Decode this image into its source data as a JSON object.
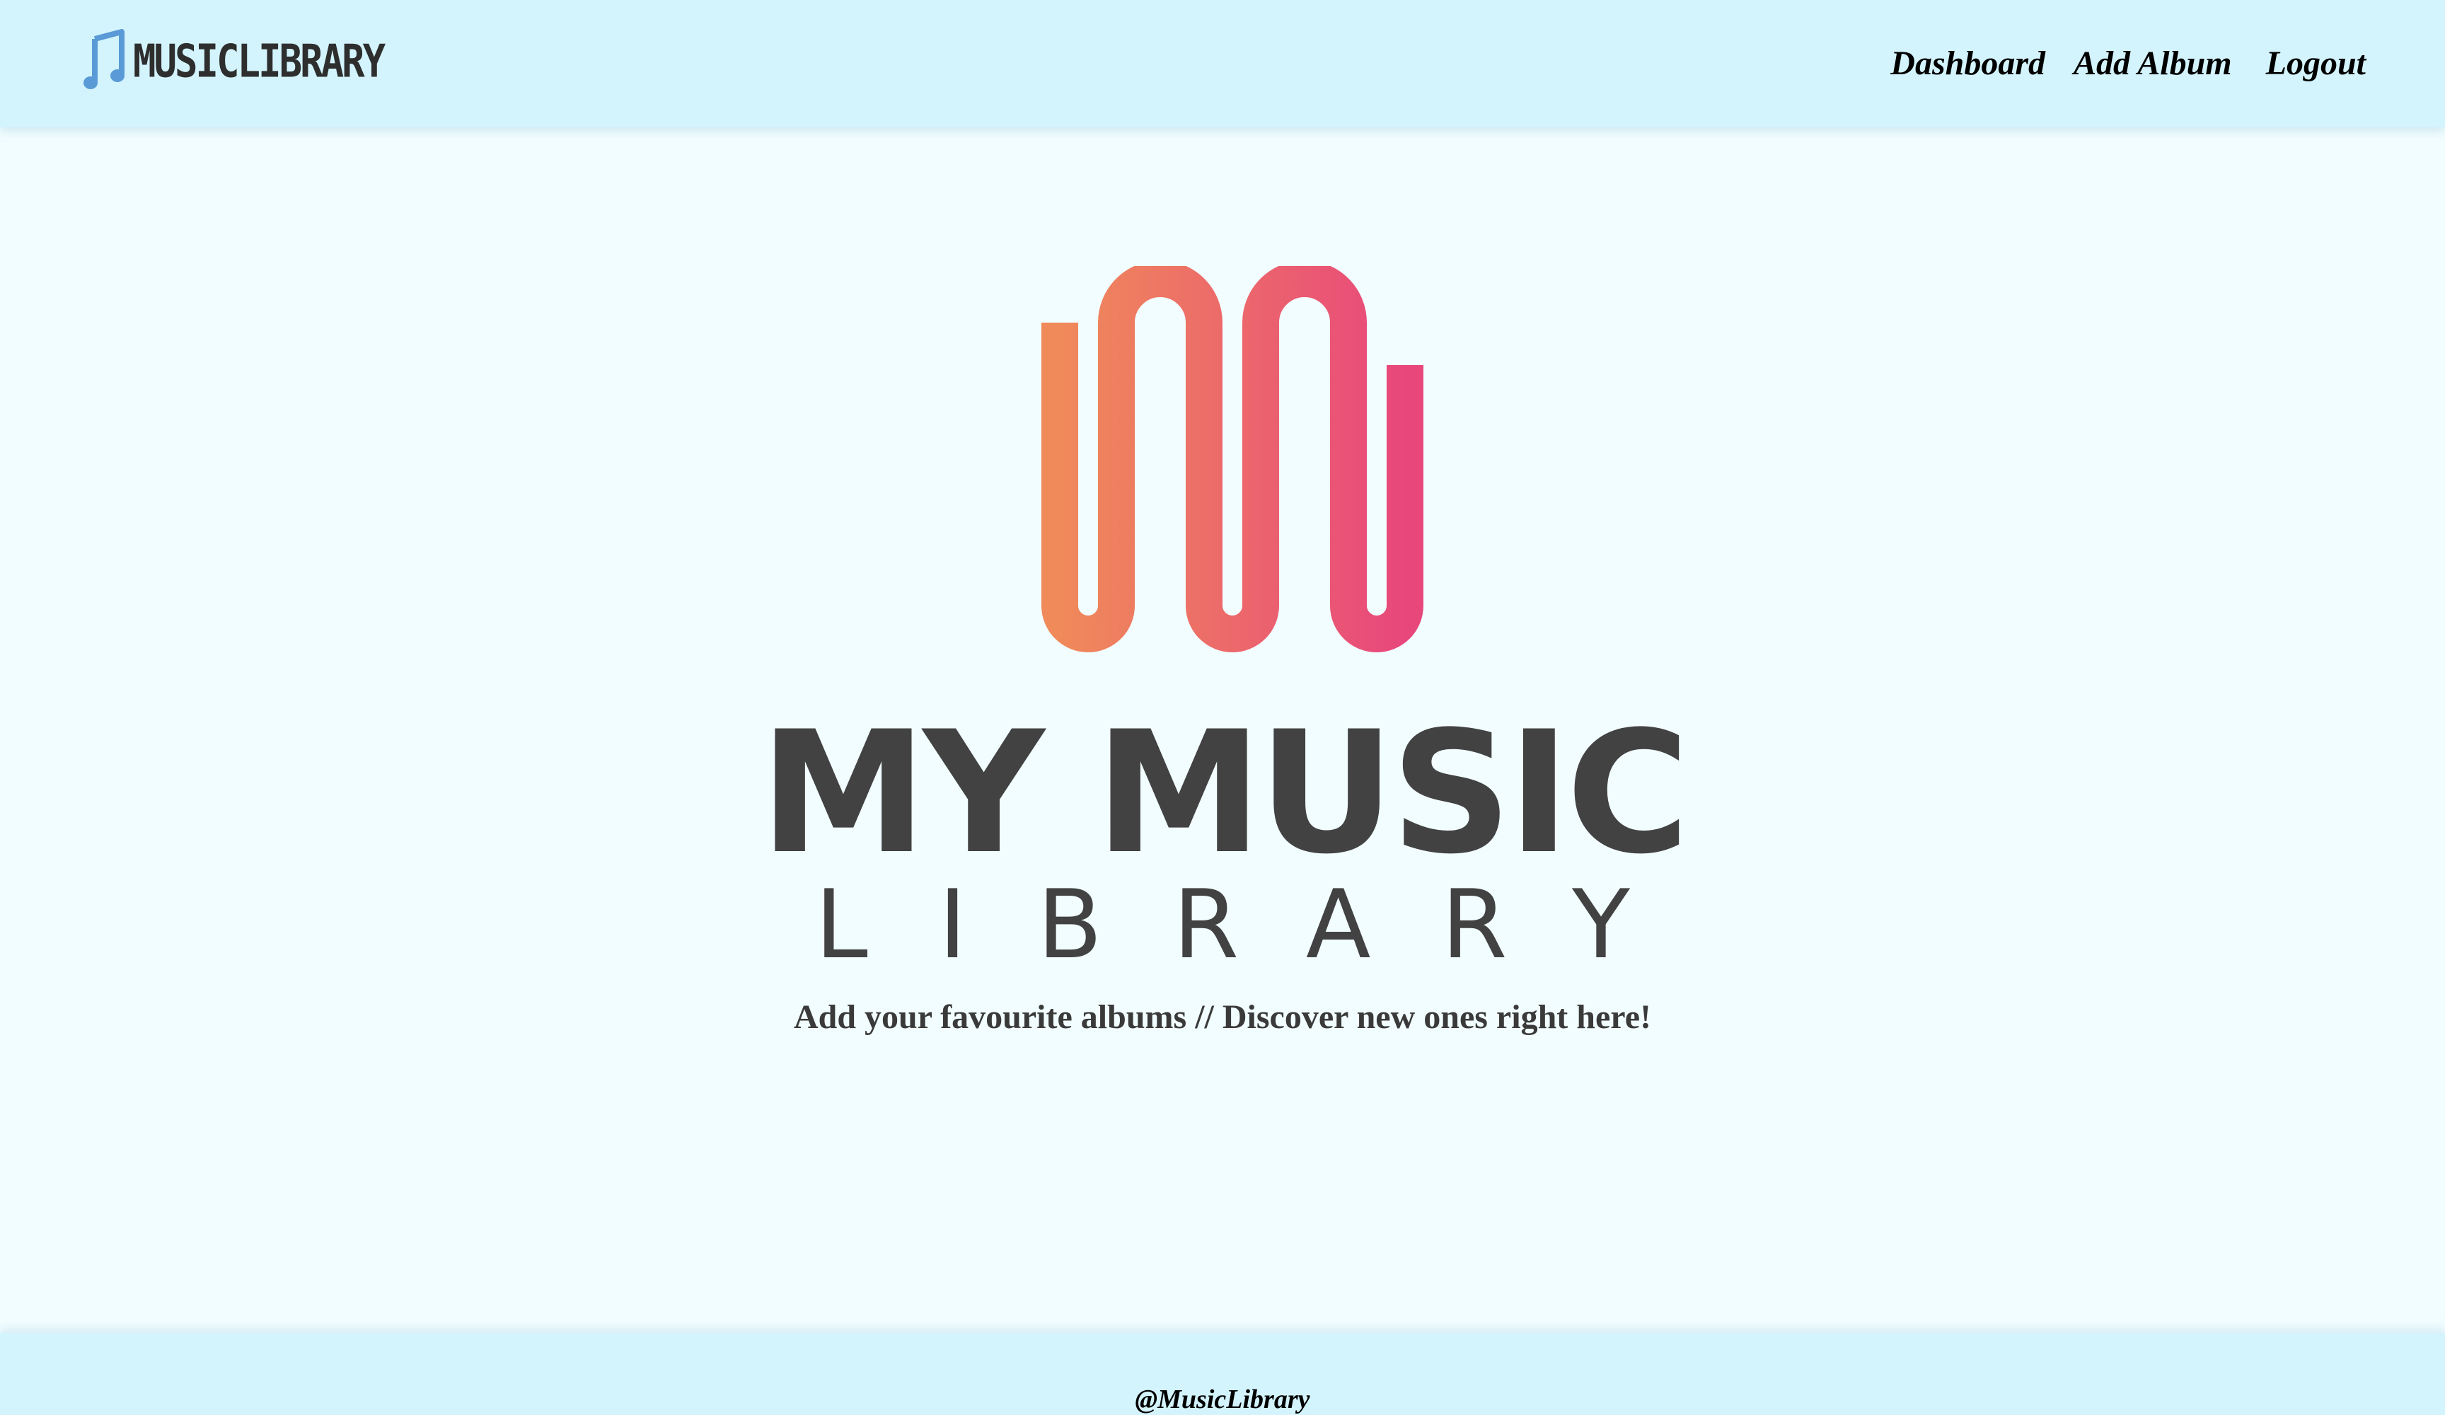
{
  "header": {
    "brand_text": "MUSICLIBRARY",
    "brand_icon": "music-note-icon",
    "nav": [
      {
        "label": "Dashboard"
      },
      {
        "label": "Add Album"
      },
      {
        "label": "Logout"
      }
    ]
  },
  "hero": {
    "logo_icon": "wave-m-logo",
    "title": "MY MUSIC",
    "subtitle": "LIBRARY",
    "tagline": "Add your favourite albums // Discover new ones right here!"
  },
  "footer": {
    "text": "@MusicLibrary"
  },
  "colors": {
    "header_bg": "#d3f4fd",
    "page_bg": "#f2fdff",
    "logo_gradient_start": "#f08a5a",
    "logo_gradient_end": "#e8477c",
    "brand_icon": "#5a9ad6",
    "title_text": "#424242"
  }
}
